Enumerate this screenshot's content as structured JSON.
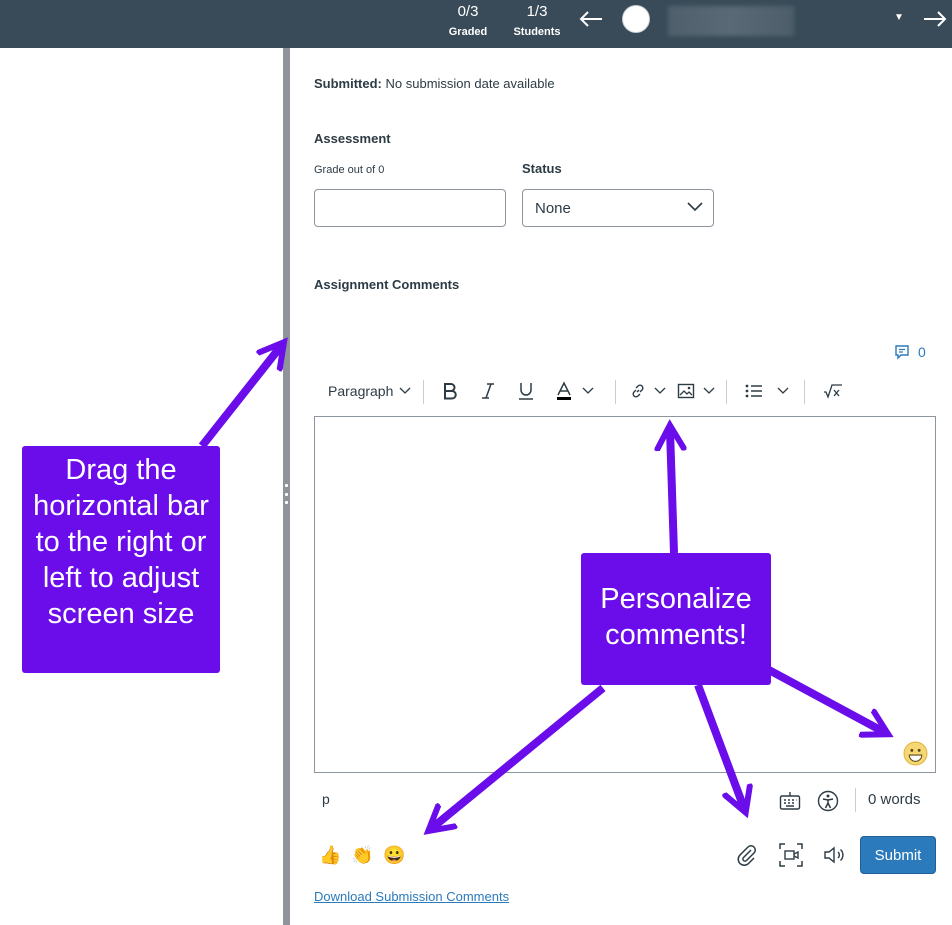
{
  "header": {
    "graded": {
      "count": "0/3",
      "label": "Graded"
    },
    "students": {
      "count": "1/3",
      "label": "Students"
    }
  },
  "submission": {
    "label": "Submitted:",
    "value": "No submission date available"
  },
  "assessment": {
    "title": "Assessment",
    "grade_label": "Grade out of 0",
    "grade_value": "",
    "status_label": "Status",
    "status_value": "None"
  },
  "comments": {
    "title": "Assignment Comments",
    "count": "0"
  },
  "editor": {
    "paragraph_label": "Paragraph",
    "path": "p",
    "word_count": "0 words"
  },
  "quick_emoji": [
    "👍",
    "👏",
    "😀"
  ],
  "actions": {
    "submit_label": "Submit",
    "download_label": "Download Submission Comments"
  },
  "annotations": {
    "left": "Drag the horizontal bar to the right or left to adjust screen size",
    "right": "Personalize comments!"
  },
  "colors": {
    "header_bg": "#394b58",
    "accent": "#2b7abc",
    "callout": "#6a0dea"
  }
}
